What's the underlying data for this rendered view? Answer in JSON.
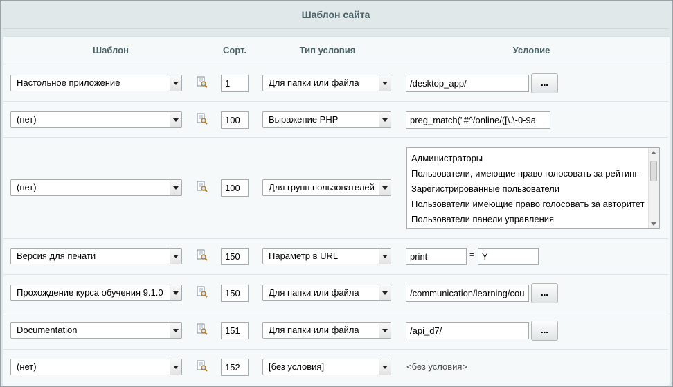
{
  "title": "Шаблон сайта",
  "columns": {
    "template": "Шаблон",
    "sort": "Сорт.",
    "cond_type": "Тип условия",
    "condition": "Условие"
  },
  "browse_label": "...",
  "equals_sign": "=",
  "rows": [
    {
      "template": "Настольное приложение",
      "sort": "1",
      "cond_type": "Для папки или файла",
      "condition": "/desktop_app/"
    },
    {
      "template": "(нет)",
      "sort": "100",
      "cond_type": "Выражение PHP",
      "condition": "preg_match(\"#^/online/([\\.\\-0-9a"
    },
    {
      "template": "(нет)",
      "sort": "100",
      "cond_type": "Для групп пользователей",
      "groups": [
        "Администраторы",
        "Пользователи, имеющие право голосовать за рейтинг",
        "Зарегистрированные пользователи",
        "Пользователи имеющие право голосовать за авторитет",
        "Пользователи панели управления"
      ]
    },
    {
      "template": "Версия для печати",
      "sort": "150",
      "cond_type": "Параметр в URL",
      "param_name": "print",
      "param_value": "Y"
    },
    {
      "template": "Прохождение курса обучения 9.1.0",
      "sort": "150",
      "cond_type": "Для папки или файла",
      "condition": "/communication/learning/cou"
    },
    {
      "template": "Documentation",
      "sort": "151",
      "cond_type": "Для папки или файла",
      "condition": "/api_d7/"
    },
    {
      "template": "(нет)",
      "sort": "152",
      "cond_type": "[без условия]",
      "no_condition": "<без условия>"
    }
  ]
}
